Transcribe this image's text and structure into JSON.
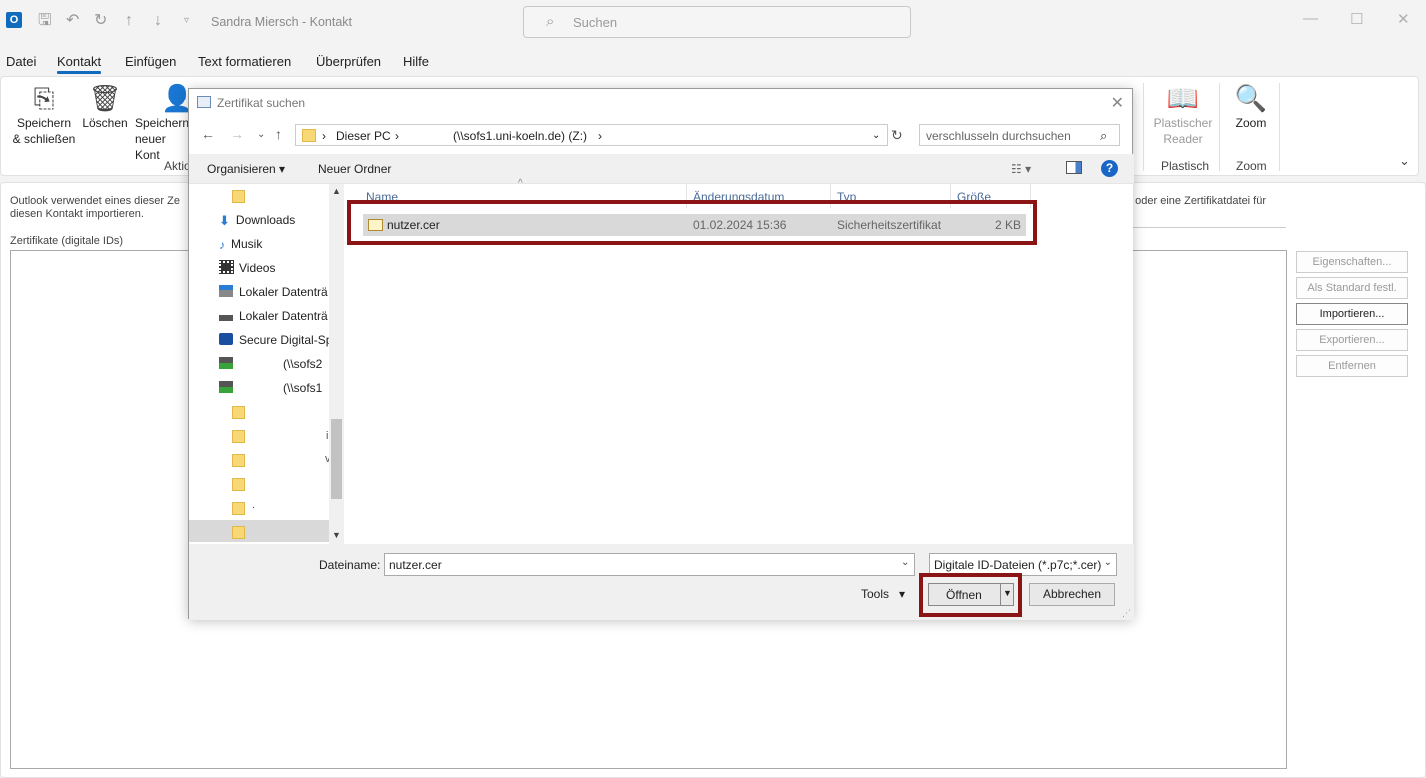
{
  "window": {
    "title": "Sandra Miersch  -  Kontakt",
    "search_placeholder": "Suchen"
  },
  "menu": [
    "Datei",
    "Kontakt",
    "Einfügen",
    "Text formatieren",
    "Überprüfen",
    "Hilfe"
  ],
  "ribbon": {
    "save_close": [
      "Speichern",
      "& schließen"
    ],
    "delete": "Löschen",
    "save_new": [
      "Speichern",
      "neuer Kont"
    ],
    "group_actions": "Aktio",
    "immersive_reader": [
      "Plastischer",
      "Reader"
    ],
    "group_plastisch": "Plastisch",
    "zoom": "Zoom",
    "group_zoom": "Zoom"
  },
  "main": {
    "info_left": "Outlook verwendet eines dieser Ze diesen Kontakt importieren.",
    "info_right": "n oder eine Zertifikatdatei für",
    "cert_label": "Zertifikate (digitale IDs)",
    "buttons": [
      "Eigenschaften...",
      "Als Standard festl.",
      "Importieren...",
      "Exportieren...",
      "Entfernen"
    ]
  },
  "dialog": {
    "title": "Zertifikat suchen",
    "path": {
      "root": "Dieser PC",
      "drive": "(\\\\sofs1.uni-koeln.de) (Z:)"
    },
    "search_placeholder": "verschlusseln durchsuchen",
    "toolbar": {
      "organize": "Organisieren",
      "new_folder": "Neuer Ordner"
    },
    "nav_items": [
      "Downloads",
      "Musik",
      "Videos",
      "Lokaler Datenträ",
      "Lokaler Datenträ",
      "Secure Digital-Sp",
      "(\\\\sofs2",
      "(\\\\sofs1"
    ],
    "nav_folder_fragments": [
      "i",
      "v",
      "."
    ],
    "columns": {
      "name": "Name",
      "date": "Änderungsdatum",
      "type": "Typ",
      "size": "Größe"
    },
    "files": [
      {
        "name": "nutzer.cer",
        "date": "01.02.2024 15:36",
        "type": "Sicherheitszertifikat",
        "size": "2 KB"
      }
    ],
    "filename_label": "Dateiname:",
    "filename_value": "nutzer.cer",
    "filter": "Digitale ID-Dateien (*.p7c;*.cer)",
    "tools": "Tools",
    "open": "Öffnen",
    "cancel": "Abbrechen"
  },
  "colors": {
    "accent": "#0f6cbd",
    "highlight": "#8b1414",
    "selection": "#d9d9d9"
  }
}
